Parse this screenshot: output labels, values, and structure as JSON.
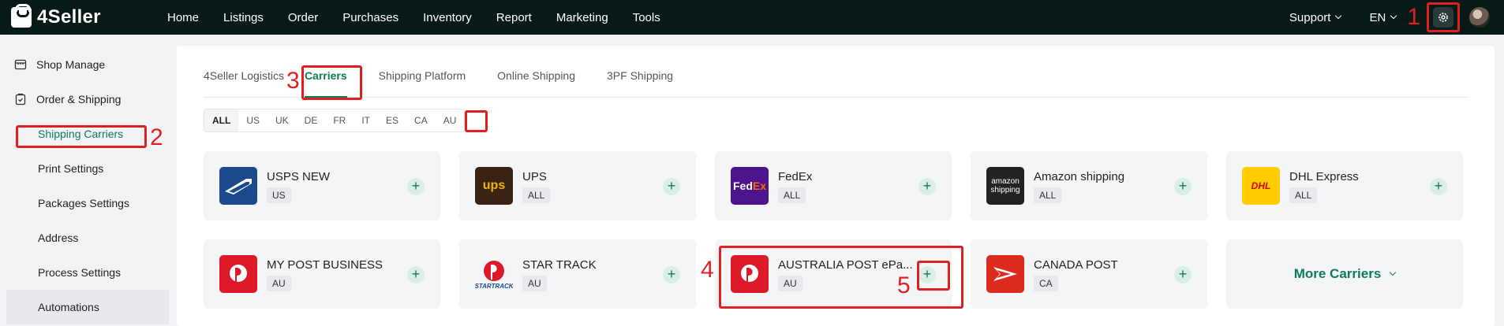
{
  "brand": {
    "name": "4Seller"
  },
  "nav": {
    "items": [
      "Home",
      "Listings",
      "Order",
      "Purchases",
      "Inventory",
      "Report",
      "Marketing",
      "Tools"
    ]
  },
  "top_right": {
    "support": "Support",
    "lang": "EN"
  },
  "sidebar": {
    "shop_manage": "Shop Manage",
    "order_shipping": "Order & Shipping",
    "items": [
      "Shipping Carriers",
      "Print Settings",
      "Packages Settings",
      "Address",
      "Process Settings",
      "Automations"
    ]
  },
  "tabs": [
    "4Seller Logistics",
    "Carriers",
    "Shipping Platform",
    "Online Shipping",
    "3PF Shipping"
  ],
  "regions": [
    "ALL",
    "US",
    "UK",
    "DE",
    "FR",
    "IT",
    "ES",
    "CA",
    "AU"
  ],
  "carriers": [
    {
      "name": "USPS NEW",
      "tag": "US"
    },
    {
      "name": "UPS",
      "tag": "ALL"
    },
    {
      "name": "FedEx",
      "tag": "ALL"
    },
    {
      "name": "Amazon shipping",
      "tag": "ALL"
    },
    {
      "name": "DHL Express",
      "tag": "ALL"
    },
    {
      "name": "MY POST BUSINESS",
      "tag": "AU"
    },
    {
      "name": "STAR TRACK",
      "tag": "AU"
    },
    {
      "name": "AUSTRALIA POST ePa...",
      "tag": "AU"
    },
    {
      "name": "CANADA POST",
      "tag": "CA"
    }
  ],
  "logo_text": {
    "ups": "ups",
    "fedex_fed": "Fed",
    "fedex_ex": "Ex",
    "amazon_1": "amazon",
    "amazon_2": "shipping",
    "dhl": "DHL",
    "startrack": "STARTRACK"
  },
  "more_carriers": "More Carriers",
  "annotations": [
    "1",
    "2",
    "3",
    "4",
    "5"
  ],
  "colors": {
    "accent": "#0f7a5c",
    "annotation": "#e02020",
    "topbar": "#071a17"
  }
}
